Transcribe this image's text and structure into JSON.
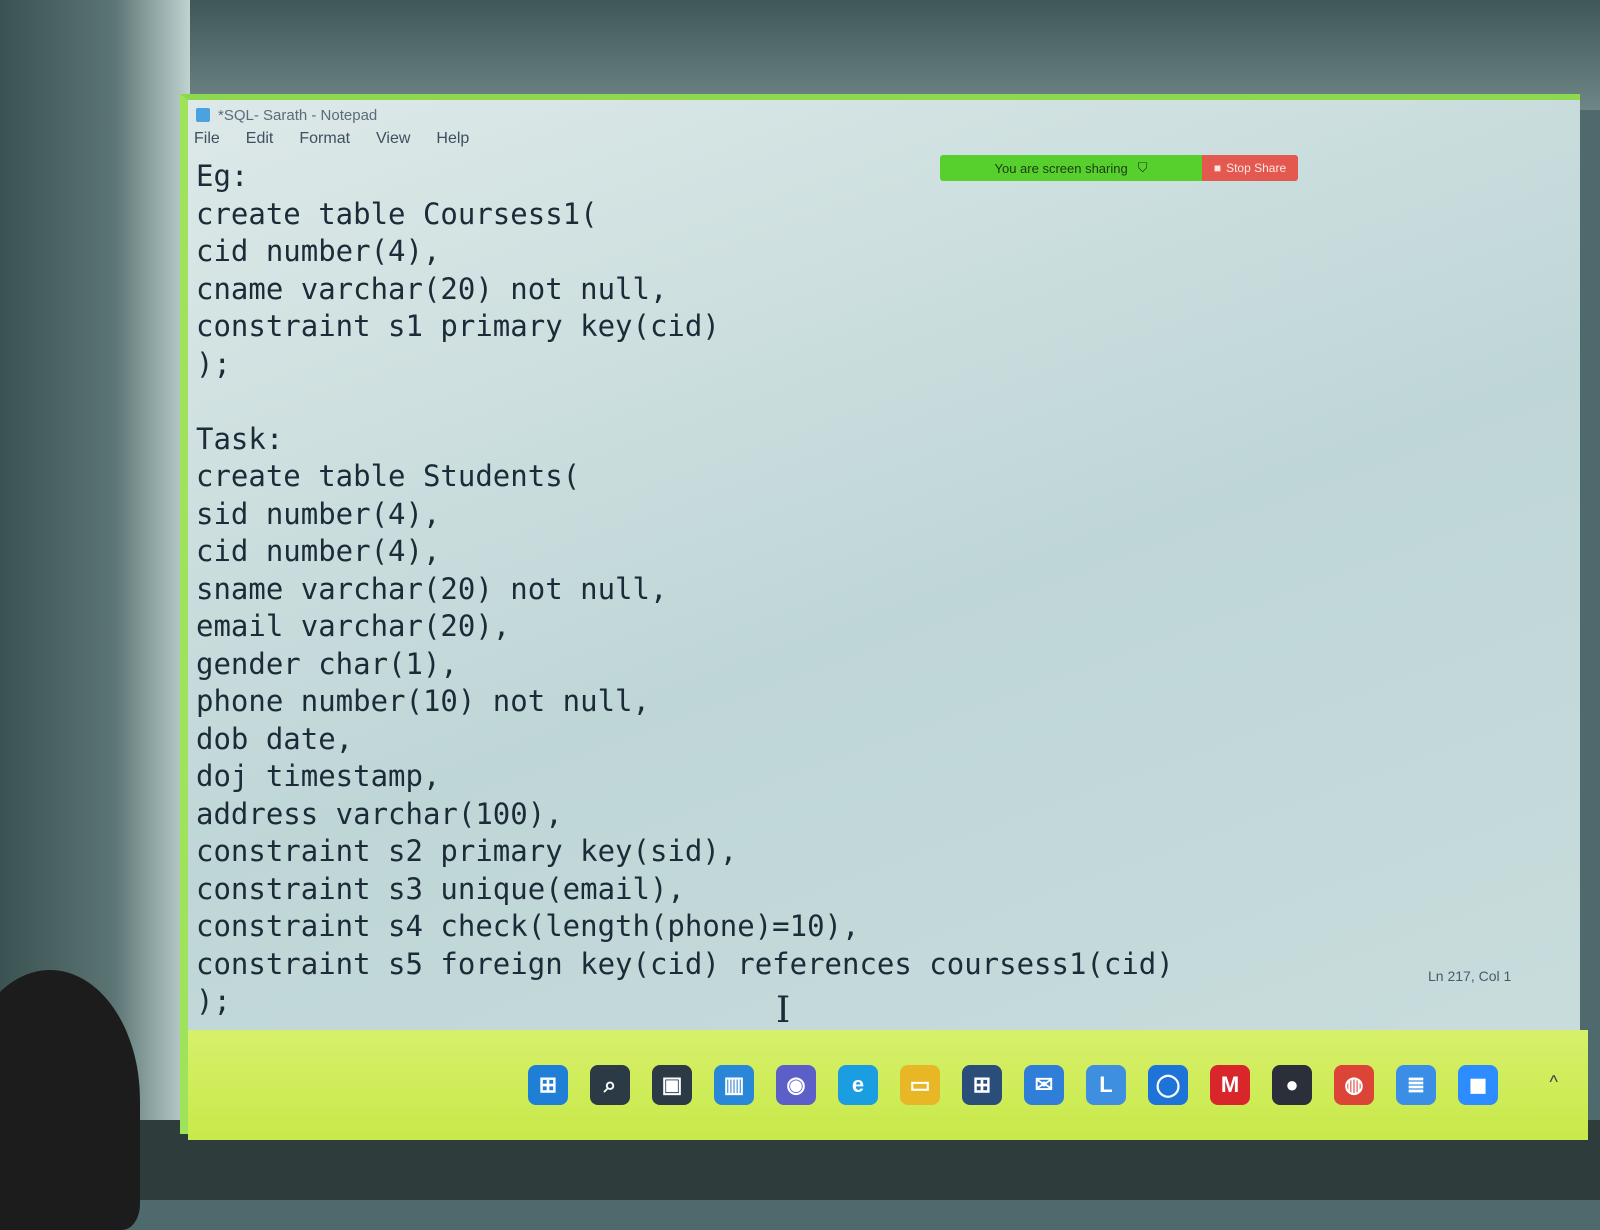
{
  "window": {
    "title": "*SQL- Sarath - Notepad"
  },
  "menu": [
    "File",
    "Edit",
    "Format",
    "View",
    "Help"
  ],
  "screen_share": {
    "status_label": "You are screen sharing",
    "stop_label": "Stop Share"
  },
  "editor": {
    "lines": [
      "Eg:",
      "create table Coursess1(",
      "cid number(4),",
      "cname varchar(20) not null,",
      "constraint s1 primary key(cid)",
      ");",
      "",
      "Task:",
      "create table Students(",
      "sid number(4),",
      "cid number(4),",
      "sname varchar(20) not null,",
      "email varchar(20),",
      "gender char(1),",
      "phone number(10) not null,",
      "dob date,",
      "doj timestamp,",
      "address varchar(100),",
      "constraint s2 primary key(sid),",
      "constraint s3 unique(email),",
      "constraint s4 check(length(phone)=10),",
      "constraint s5 foreign key(cid) references coursess1(cid)",
      ");"
    ]
  },
  "status_bar": {
    "position": "Ln 217, Col 1"
  },
  "taskbar": {
    "icons": [
      {
        "name": "start-icon",
        "color": "#1f7fd6",
        "glyph": "⊞"
      },
      {
        "name": "search-icon",
        "color": "#2c3a46",
        "glyph": "⌕"
      },
      {
        "name": "task-view-icon",
        "color": "#2c3a46",
        "glyph": "▣"
      },
      {
        "name": "widgets-icon",
        "color": "#2a86d6",
        "glyph": "▥"
      },
      {
        "name": "teams-chat-icon",
        "color": "#5b5fc7",
        "glyph": "◉"
      },
      {
        "name": "edge-icon",
        "color": "#1b9de2",
        "glyph": "e"
      },
      {
        "name": "file-explorer-icon",
        "color": "#e8b725",
        "glyph": "▭"
      },
      {
        "name": "store-icon",
        "color": "#2b4d7a",
        "glyph": "⊞"
      },
      {
        "name": "mail-icon",
        "color": "#2f7ed8",
        "glyph": "✉"
      },
      {
        "name": "app-l-icon",
        "color": "#3f8fe0",
        "glyph": "L"
      },
      {
        "name": "app-blue-icon",
        "color": "#1e73d9",
        "glyph": "◯"
      },
      {
        "name": "mcafee-icon",
        "color": "#d8262a",
        "glyph": "M"
      },
      {
        "name": "app-dark-icon",
        "color": "#2a2f3a",
        "glyph": "●"
      },
      {
        "name": "chrome-icon",
        "color": "#db4437",
        "glyph": "◍"
      },
      {
        "name": "notepad-icon",
        "color": "#3a8ee6",
        "glyph": "≣"
      },
      {
        "name": "zoom-icon",
        "color": "#2d8cff",
        "glyph": "◼"
      }
    ]
  }
}
